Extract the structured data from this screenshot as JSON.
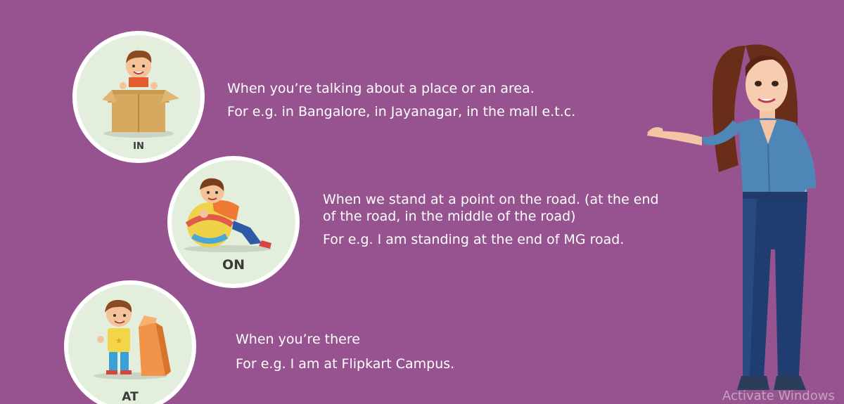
{
  "prepositions": {
    "in": {
      "label": "IN",
      "line1": "When you’re talking about a place or an area.",
      "line2": "For e.g. in Bangalore, in Jayanagar, in the mall e.t.c."
    },
    "on": {
      "label": "ON",
      "line1": "When we stand at a point on the road. (at the end",
      "line1b": "of the road, in the middle of the road)",
      "line2": "For e.g. I am standing at the end of MG road."
    },
    "at": {
      "label": "AT",
      "line1": "When you’re there",
      "line2": "For e.g. I am at Flipkart Campus."
    }
  },
  "watermark": "Activate Windows",
  "colors": {
    "background": "#97538f",
    "badge_fill": "#e3eedd",
    "badge_border": "#ffffff",
    "text": "#ffffff"
  }
}
